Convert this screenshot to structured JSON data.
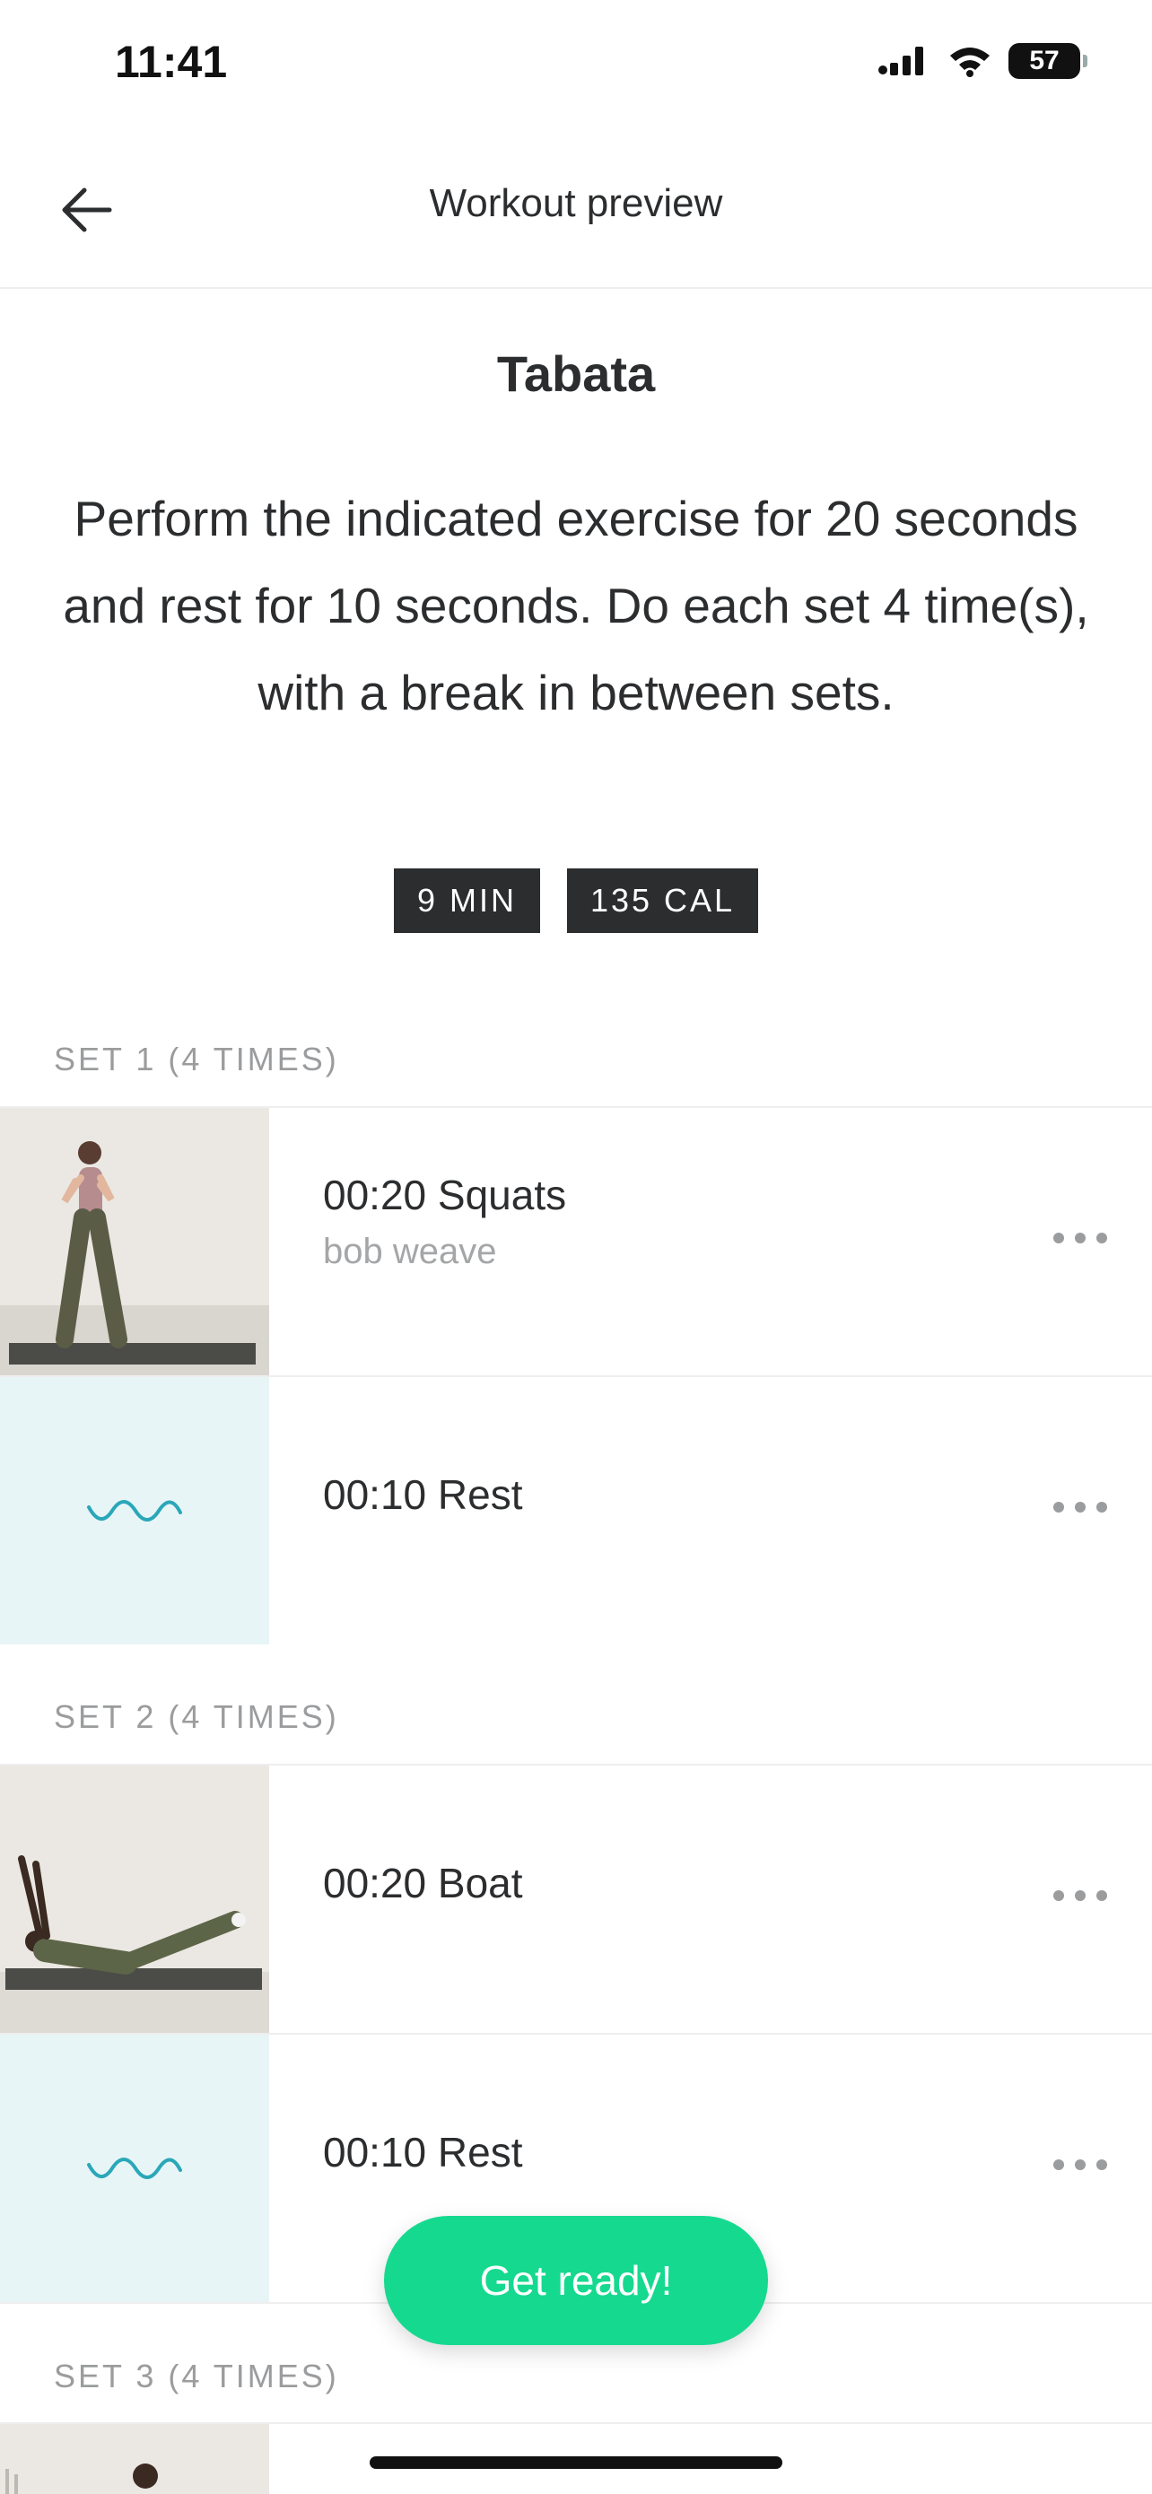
{
  "status_bar": {
    "time": "11:41",
    "battery": "57"
  },
  "header": {
    "title": "Workout preview"
  },
  "workout": {
    "title": "Tabata",
    "description": "Perform the indicated exercise for 20 seconds and rest for 10 seconds. Do each set 4 time(s), with a break in between sets.",
    "badges": [
      "9 MIN",
      "135 CAL"
    ]
  },
  "sets": [
    {
      "label": "SET 1 (4 TIMES)",
      "items": [
        {
          "title": "00:20 Squats",
          "subtitle": "bob weave",
          "type": "exercise"
        },
        {
          "title": "00:10 Rest",
          "type": "rest"
        }
      ]
    },
    {
      "label": "SET 2 (4 TIMES)",
      "items": [
        {
          "title": "00:20 Boat",
          "type": "exercise"
        },
        {
          "title": "00:10 Rest",
          "type": "rest"
        }
      ]
    },
    {
      "label": "SET 3 (4 TIMES)",
      "items": []
    }
  ],
  "cta": {
    "label": "Get ready!"
  },
  "colors": {
    "accent": "#15d98f",
    "rest_bg": "#e8f5f7",
    "rest_wave": "#2aa7b8",
    "badge_bg": "#2b2d2f"
  }
}
